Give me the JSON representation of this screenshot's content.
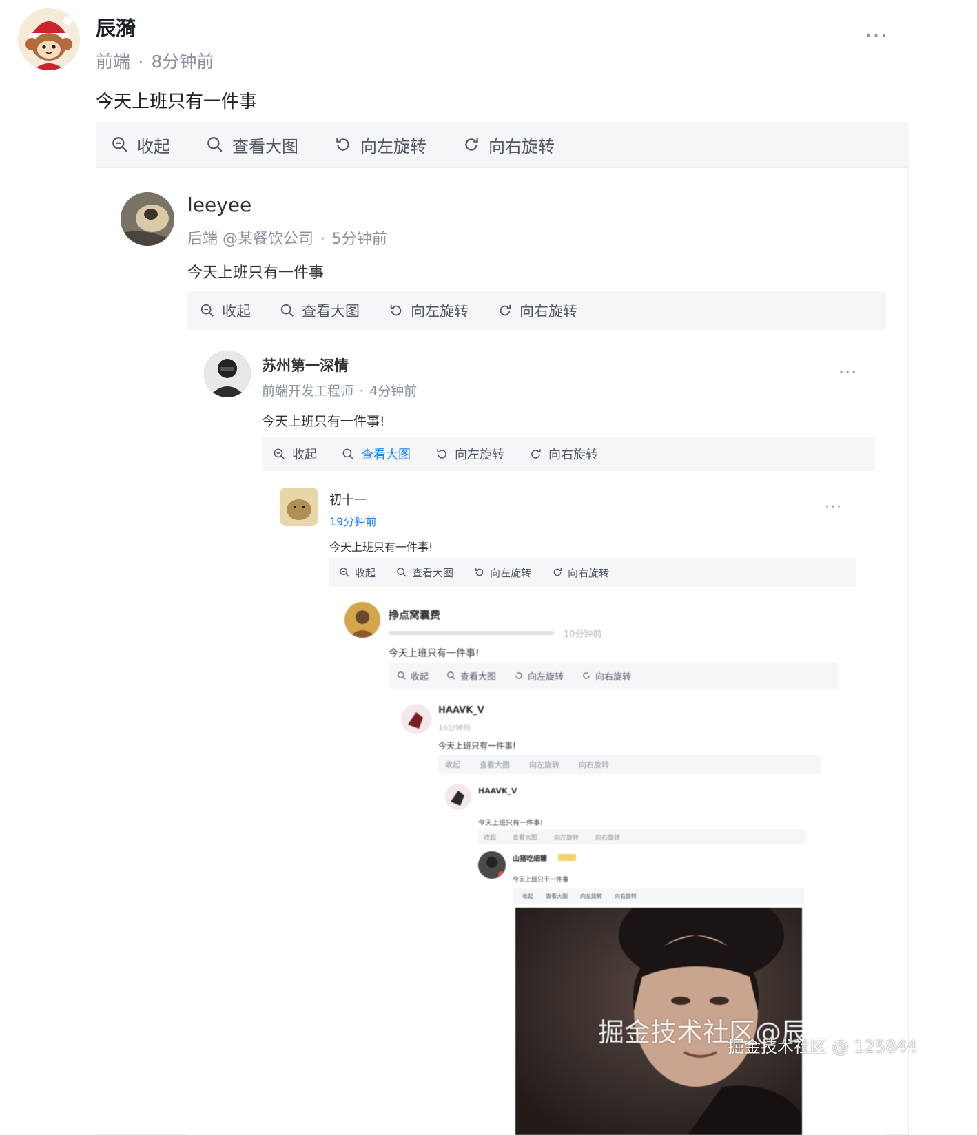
{
  "post": {
    "author": "辰漪",
    "meta": "前端",
    "time": "8分钟前",
    "content": "今天上班只有一件事",
    "toolbar": [
      "收起",
      "查看大图",
      "向左旋转",
      "向右旋转"
    ]
  },
  "nested": [
    {
      "author": "leeyee",
      "meta": "后端 @某餐饮公司",
      "time": "5分钟前",
      "content": "今天上班只有一件事",
      "toolbar": [
        "收起",
        "查看大图",
        "向左旋转",
        "向右旋转"
      ]
    },
    {
      "author": "苏州第一深情",
      "meta": "前端开发工程师",
      "time": "4分钟前",
      "content": "今天上班只有一件事!",
      "toolbar": [
        "收起",
        "查看大图",
        "向左旋转",
        "向右旋转"
      ]
    },
    {
      "author": "初十一",
      "meta": "",
      "time": "19分钟前",
      "content": "今天上班只有一件事!",
      "toolbar": [
        "收起",
        "查看大图",
        "向左旋转",
        "向右旋转"
      ]
    },
    {
      "author": "挣点窝囊费",
      "meta": "",
      "time": "10分钟前",
      "content": "今天上班只有一件事!",
      "toolbar": [
        "收起",
        "查看大图",
        "向左旋转",
        "向右旋转"
      ]
    },
    {
      "author": "HAAVK_V",
      "meta": "",
      "time": "16分钟前",
      "content": "今天上班只有一件事!",
      "toolbar": [
        "收起",
        "查看大图",
        "向左旋转",
        "向右旋转"
      ]
    },
    {
      "author": "HAAVK_V",
      "meta": "",
      "time": "",
      "content": "今天上班只有一件事!",
      "toolbar": [
        "收起",
        "查看大图",
        "向左旋转",
        "向右旋转"
      ]
    },
    {
      "author": "山猪吃细糠",
      "meta": "",
      "time": "",
      "content": "今天上班只干一件事",
      "toolbar": [
        "收起",
        "查看大图",
        "向左旋转",
        "向右旋转"
      ]
    }
  ],
  "watermark": {
    "inner": "掘金技术社区@辰漪",
    "outer": "掘金技术社区 @ 125844"
  },
  "colors": {
    "accent": "#1e80ff",
    "meta": "#8a919f",
    "toolbar_bg": "#f5f6f7"
  }
}
